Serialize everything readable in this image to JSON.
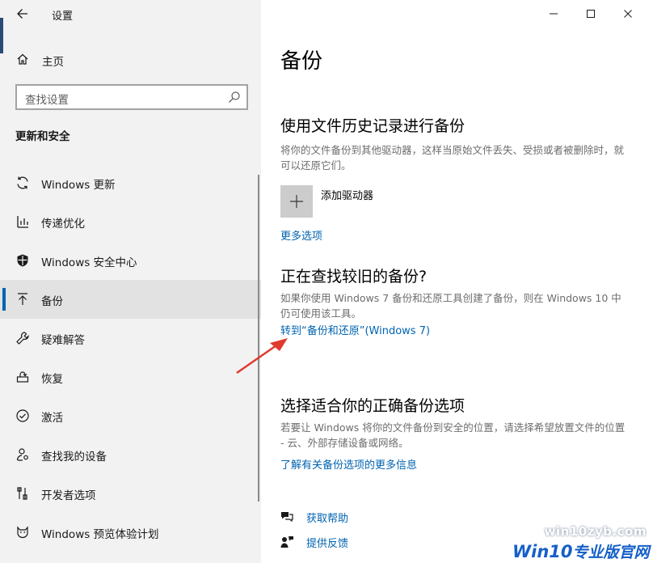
{
  "window": {
    "title": "设置",
    "controls": [
      "minimize",
      "maximize",
      "close"
    ]
  },
  "sidebar": {
    "home_label": "主页",
    "search_placeholder": "查找设置",
    "section_title": "更新和安全",
    "items": [
      {
        "label": "Windows 更新",
        "icon": "sync-icon"
      },
      {
        "label": "传递优化",
        "icon": "delivery-icon"
      },
      {
        "label": "Windows 安全中心",
        "icon": "shield-icon"
      },
      {
        "label": "备份",
        "icon": "upload-arrow-icon",
        "selected": true
      },
      {
        "label": "疑难解答",
        "icon": "wrench-icon"
      },
      {
        "label": "恢复",
        "icon": "recovery-icon"
      },
      {
        "label": "激活",
        "icon": "check-circle-icon"
      },
      {
        "label": "查找我的设备",
        "icon": "person-locate-icon"
      },
      {
        "label": "开发者选项",
        "icon": "tools-icon"
      },
      {
        "label": "Windows 预览体验计划",
        "icon": "cat-icon"
      }
    ]
  },
  "main": {
    "page_title": "备份",
    "file_history": {
      "heading": "使用文件历史记录进行备份",
      "description": "将你的文件备份到其他驱动器，这样当原始文件丢失、受损或者被删除时，就可以还原它们。",
      "add_drive_label": "添加驱动器",
      "more_options_link": "更多选项"
    },
    "older_backup": {
      "heading": "正在查找较旧的备份?",
      "description": "如果你使用 Windows 7 备份和还原工具创建了备份，则在 Windows 10 中仍可使用该工具。",
      "link": "转到“备份和还原”(Windows 7)"
    },
    "choose_options": {
      "heading": "选择适合你的正确备份选项",
      "description": "若要让 Windows 将你的文件备份到安全的位置，请选择希望放置文件的位置 - 云、外部存储设备或网络。",
      "link": "了解有关备份选项的更多信息"
    },
    "help": {
      "get_help": "获取帮助",
      "feedback": "提供反馈"
    }
  },
  "watermark": {
    "site": "win10zyb.com",
    "brand_win": "Win10",
    "brand_rest": "专业版官网"
  },
  "colors": {
    "sidebar_bg": "#f2f2f2",
    "selected_bg": "#e2e2e2",
    "accent": "#0063b1",
    "arrow": "#e03a2e"
  }
}
